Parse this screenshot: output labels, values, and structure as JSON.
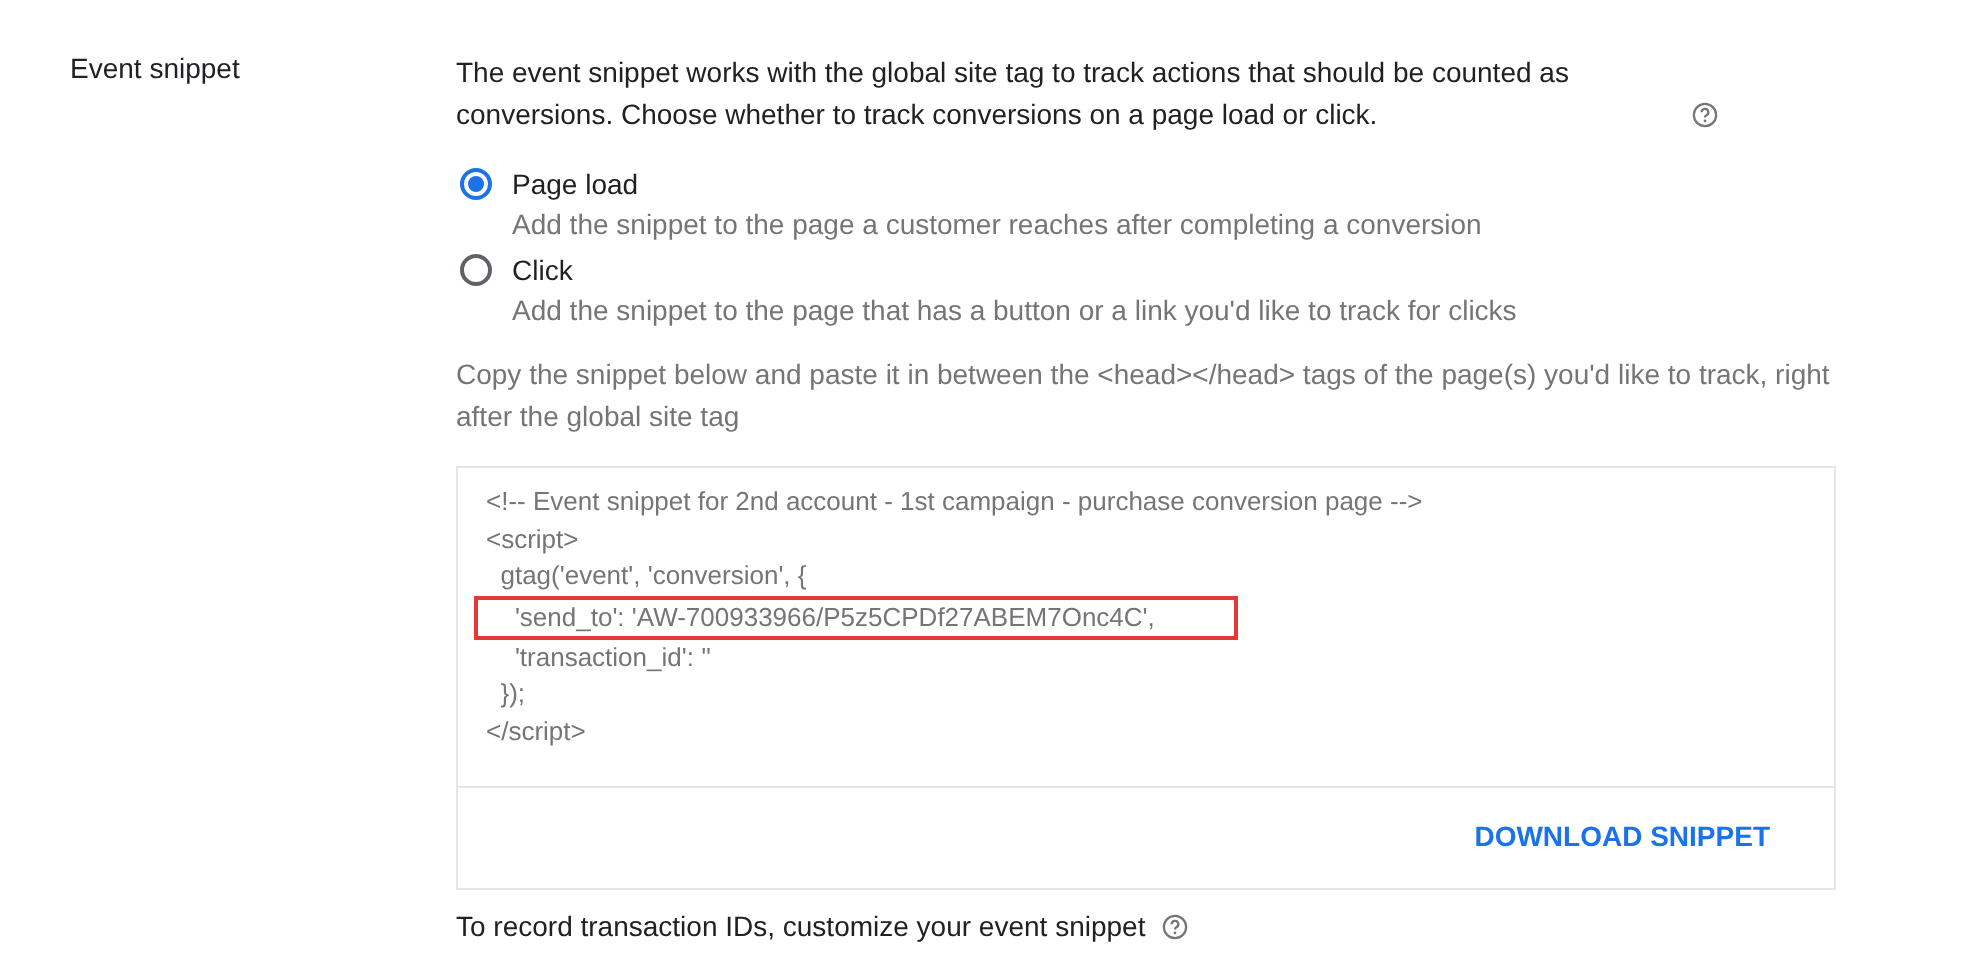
{
  "section_label": "Event snippet",
  "intro": "The event snippet works with the global site tag to track actions that should be counted as conversions. Choose whether to track conversions on a page load or click.",
  "options": [
    {
      "label": "Page load",
      "description": "Add the snippet to the page a customer reaches after completing a conversion",
      "selected": true
    },
    {
      "label": "Click",
      "description": "Add the snippet to the page that has a button or a link you'd like to track for clicks",
      "selected": false
    }
  ],
  "instructions": "Copy the snippet below and paste it in between the <head></head> tags of the page(s) you'd like to track, right after the global site tag",
  "code_lines": [
    {
      "text": "<!-- Event snippet for 2nd account - 1st campaign - purchase conversion page -->",
      "highlighted": false
    },
    {
      "text": "<script>",
      "highlighted": false
    },
    {
      "text": "  gtag('event', 'conversion', {",
      "highlighted": false
    },
    {
      "text": "    'send_to': 'AW-700933966/P5z5CPDf27ABEM7Onc4C',",
      "highlighted": true
    },
    {
      "text": "    'transaction_id': ''",
      "highlighted": false
    },
    {
      "text": "  });",
      "highlighted": false
    },
    {
      "text": "</script>",
      "highlighted": false
    }
  ],
  "download_button": "DOWNLOAD SNIPPET",
  "footer": "To record transaction IDs, customize your event snippet"
}
